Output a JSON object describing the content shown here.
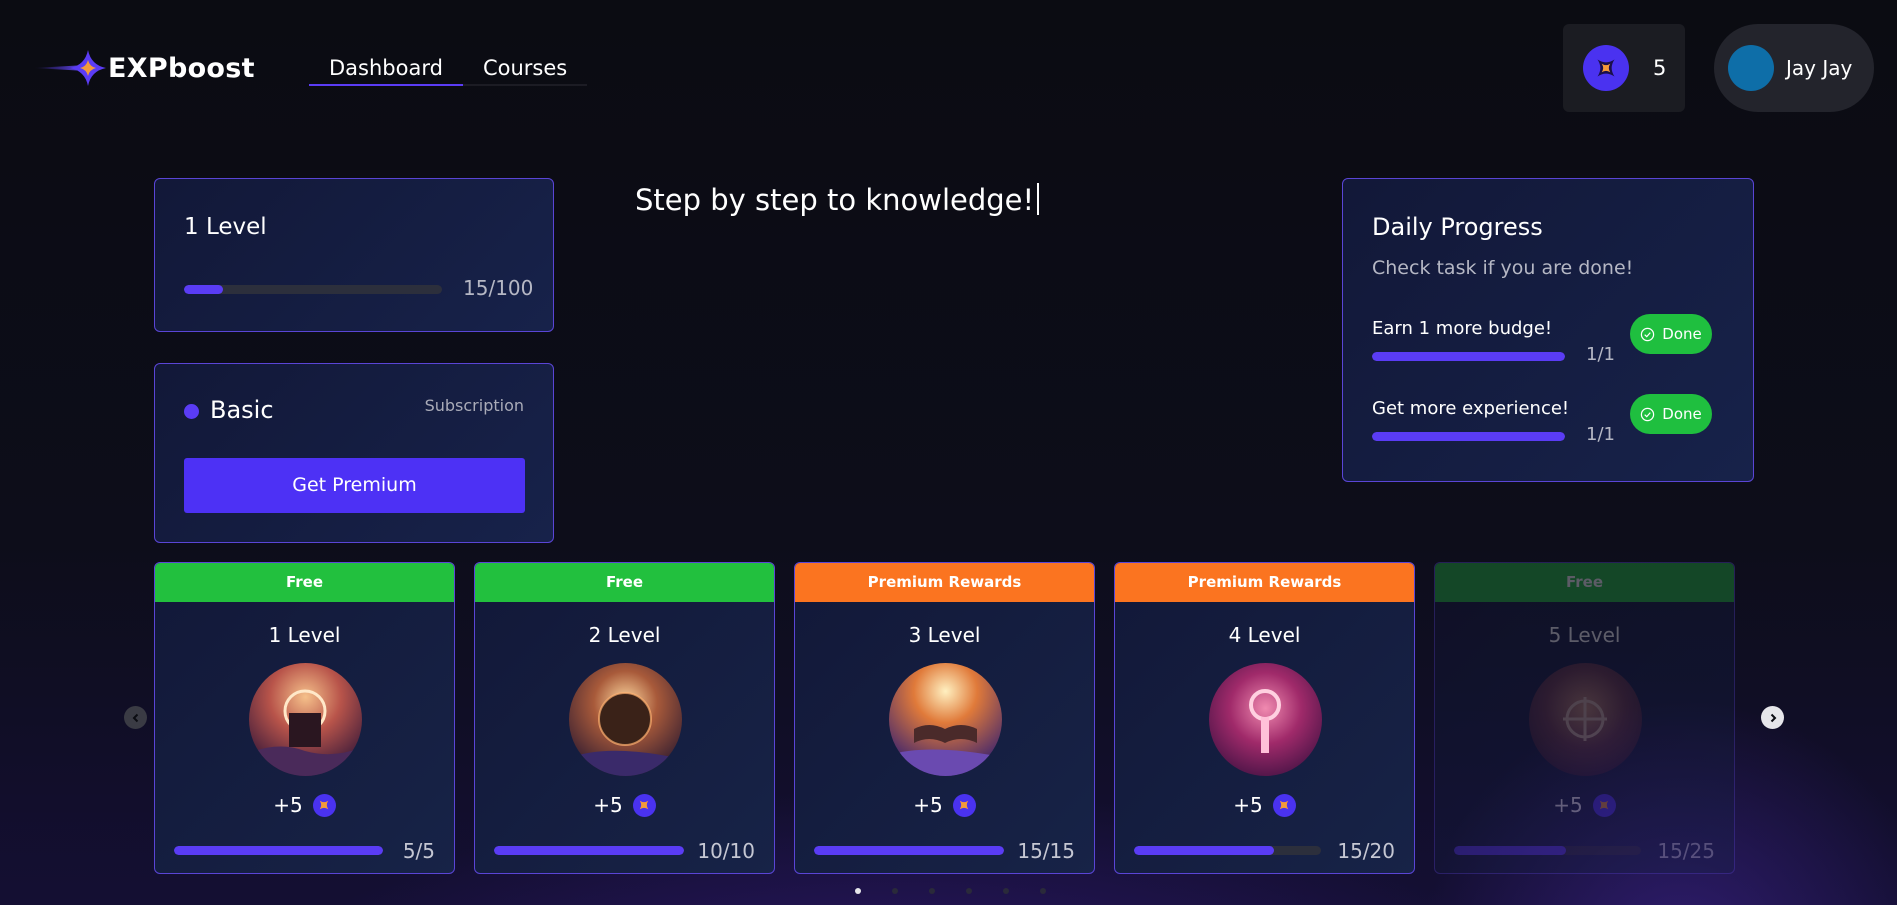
{
  "header": {
    "brand": "EXPboost",
    "nav": [
      {
        "label": "Dashboard",
        "active": true
      },
      {
        "label": "Courses",
        "active": false
      }
    ],
    "points": "5",
    "user_name": "Jay Jay"
  },
  "level_panel": {
    "title": "1 Level",
    "progress": 0.15,
    "count": "15/100"
  },
  "subscription": {
    "plan": "Basic",
    "label": "Subscription",
    "button": "Get Premium"
  },
  "headline": "Step by step to knowledge!",
  "daily": {
    "title": "Daily Progress",
    "subtitle": "Check task if you are done!",
    "tasks": [
      {
        "label": "Earn 1 more budge!",
        "count": "1/1",
        "progress": 1.0,
        "button": "Done"
      },
      {
        "label": "Get more experience!",
        "count": "1/1",
        "progress": 1.0,
        "button": "Done"
      }
    ]
  },
  "levels": [
    {
      "badge": "Free",
      "title": "1 Level",
      "reward": "+5",
      "count": "5/5",
      "progress": 1.0
    },
    {
      "badge": "Free",
      "title": "2 Level",
      "reward": "+5",
      "count": "10/10",
      "progress": 1.0
    },
    {
      "badge": "Premium Rewards",
      "title": "3 Level",
      "reward": "+5",
      "count": "15/15",
      "progress": 1.0
    },
    {
      "badge": "Premium Rewards",
      "title": "4 Level",
      "reward": "+5",
      "count": "15/20",
      "progress": 0.75
    },
    {
      "badge": "Free",
      "title": "5 Level",
      "reward": "+5",
      "count": "15/25",
      "progress": 0.6
    }
  ],
  "carousel": {
    "pages": 6,
    "active": 0
  },
  "colors": {
    "accent": "#5a3cf5",
    "free": "#22c03e",
    "premium": "#fb7420",
    "done": "#1fbf3f"
  }
}
